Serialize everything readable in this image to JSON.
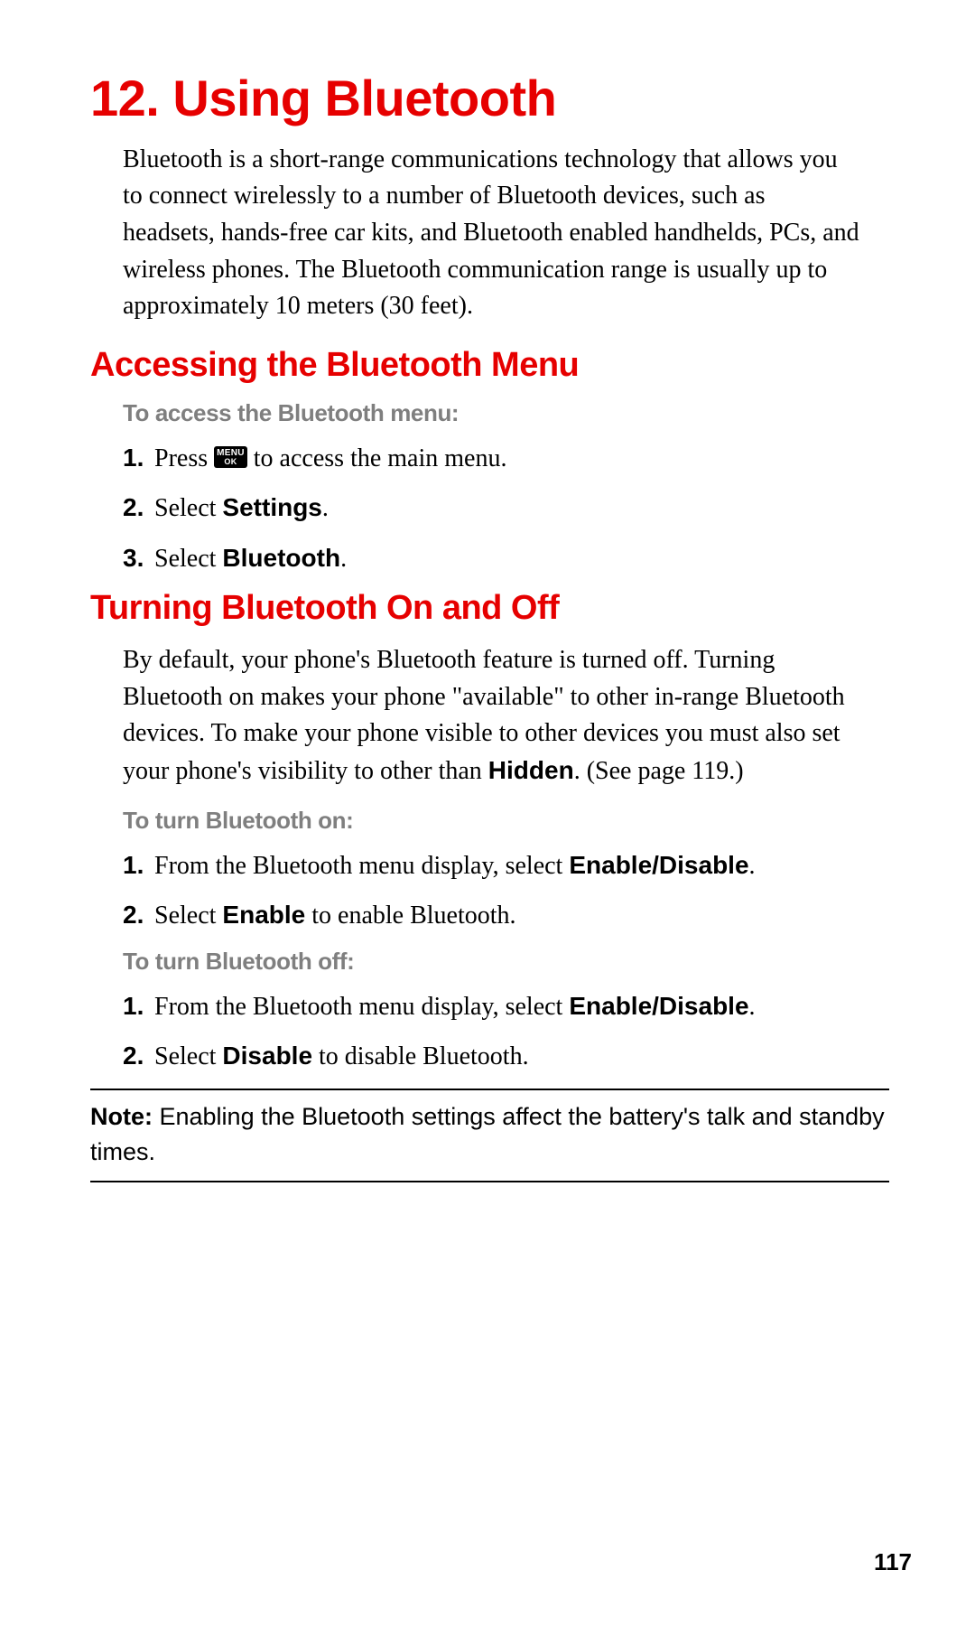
{
  "chapter": {
    "title": "12. Using Bluetooth",
    "intro": "Bluetooth is a short-range communications technology that allows you to connect wirelessly to a number of Bluetooth devices, such as headsets, hands-free car kits, and Bluetooth enabled handhelds, PCs, and wireless phones. The Bluetooth communication range is usually up to approximately 10 meters (30 feet)."
  },
  "section_access": {
    "title": "Accessing the Bluetooth Menu",
    "subhead": "To access the Bluetooth menu:",
    "step1_num": "1.",
    "step1_a": "Press ",
    "step1_b": " to access the main menu.",
    "menu_key_line1": "MENU",
    "menu_key_line2": "OK",
    "step2_num": "2.",
    "step2_a": "Select ",
    "step2_bold": "Settings",
    "step2_b": ".",
    "step3_num": "3.",
    "step3_a": "Select ",
    "step3_bold": "Bluetooth",
    "step3_b": "."
  },
  "section_onoff": {
    "title": "Turning Bluetooth On and Off",
    "para_a": "By default, your phone's Bluetooth feature is turned off. Turning Bluetooth on makes your phone \"available\" to other in-range Bluetooth devices. To make your phone visible to other devices you must also set your phone's visibility to other than ",
    "para_bold": "Hidden",
    "para_b": ". (See page 119.)",
    "subhead_on": "To turn Bluetooth on:",
    "on_step1_num": "1.",
    "on_step1_a": "From the Bluetooth menu display, select ",
    "on_step1_bold": "Enable/Disable",
    "on_step1_b": ".",
    "on_step2_num": "2.",
    "on_step2_a": "Select ",
    "on_step2_bold": "Enable",
    "on_step2_b": " to enable Bluetooth.",
    "subhead_off": "To turn Bluetooth off:",
    "off_step1_num": "1.",
    "off_step1_a": "From the Bluetooth menu display, select ",
    "off_step1_bold": "Enable/Disable",
    "off_step1_b": ".",
    "off_step2_num": "2.",
    "off_step2_a": "Select ",
    "off_step2_bold": "Disable",
    "off_step2_b": " to disable Bluetooth."
  },
  "note": {
    "label": "Note:",
    "text": " Enabling the Bluetooth settings affect the battery's talk and standby times."
  },
  "page_number": "117"
}
